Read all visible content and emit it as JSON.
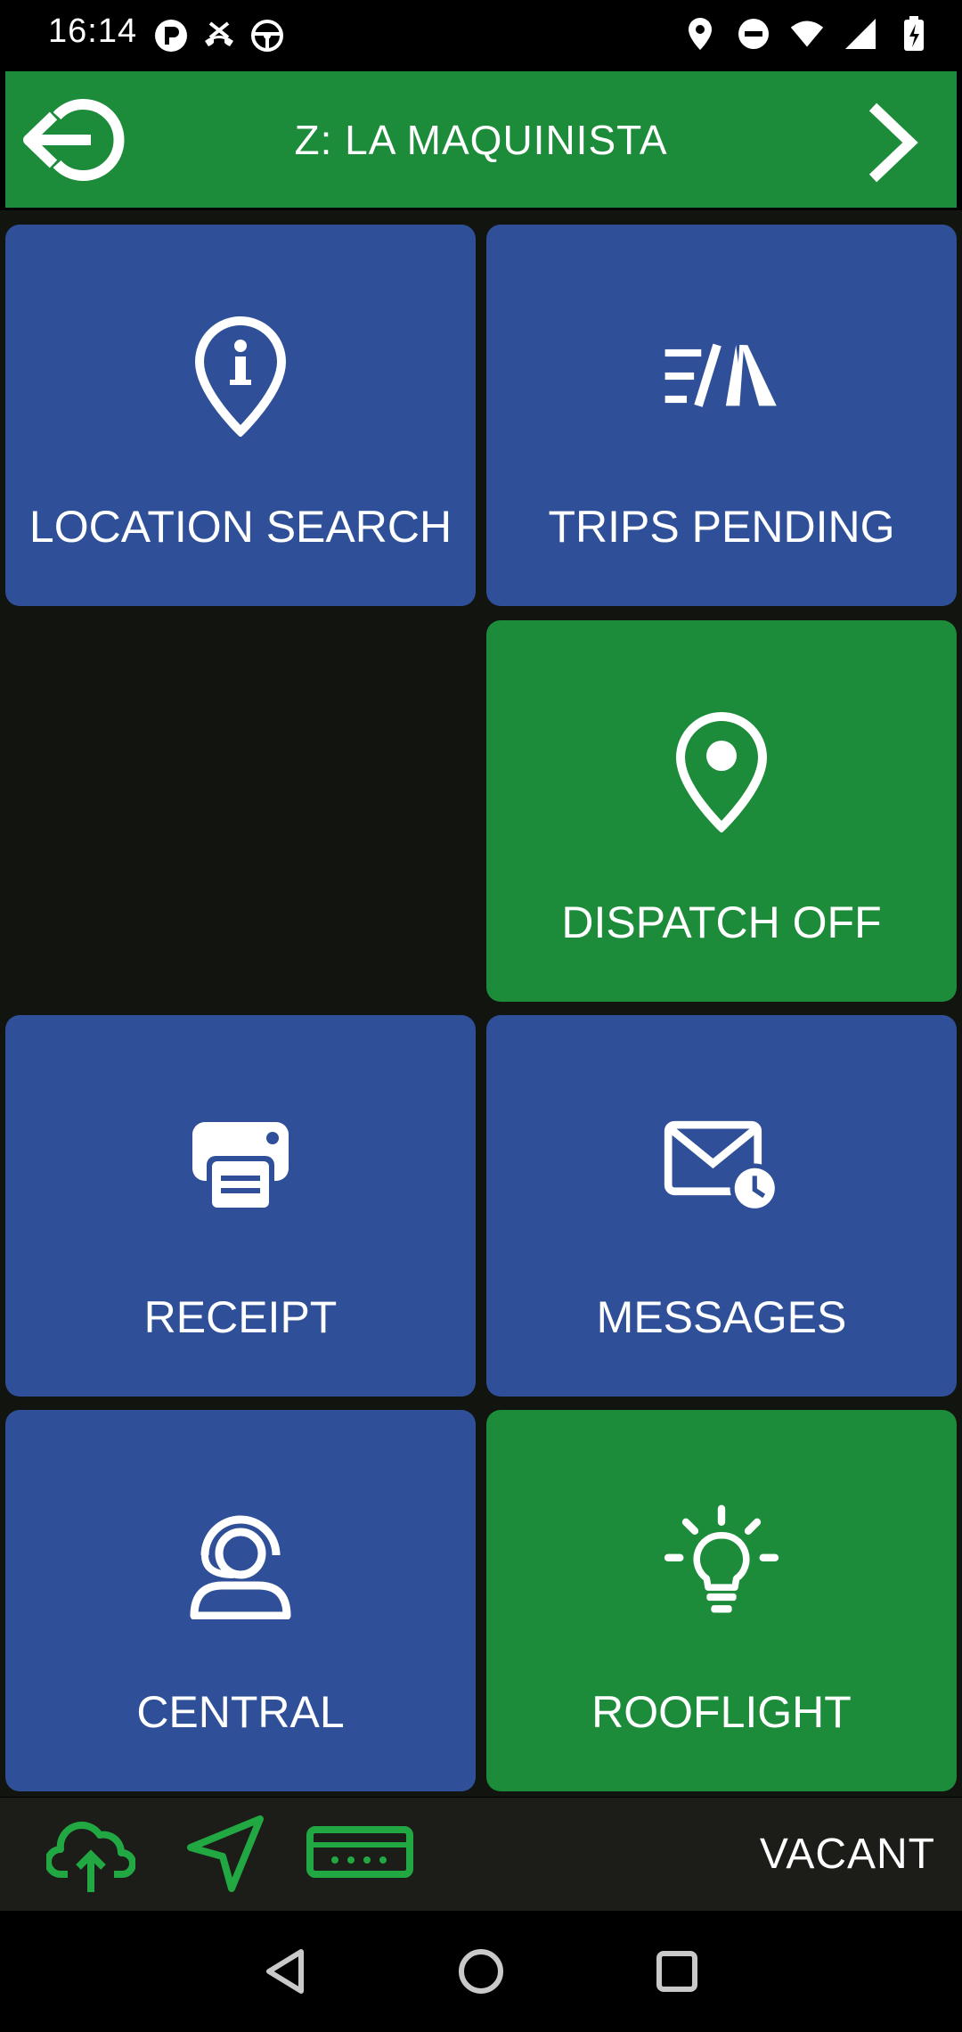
{
  "status_bar": {
    "time": "16:14",
    "left_icons": [
      "p-circle-icon",
      "call-end-icon",
      "steering-wheel-icon"
    ],
    "right_icons": [
      "location-pin-icon",
      "do-not-disturb-icon",
      "wifi-icon",
      "signal-icon",
      "battery-charging-icon"
    ]
  },
  "header": {
    "title": "Z: LA MAQUINISTA",
    "back_icon": "logout-arrow-icon",
    "next_icon": "chevron-right-icon",
    "color": "#1c8b3a"
  },
  "tiles": [
    {
      "label": "LOCATION SEARCH",
      "icon": "location-info-icon",
      "color": "#2f5098"
    },
    {
      "label": "TRIPS PENDING",
      "icon": "road-lines-icon",
      "color": "#2f5098"
    },
    {
      "label": "DISPATCH OFF",
      "icon": "map-pin-icon",
      "color": "#1c8b3a"
    },
    {
      "label": "RECEIPT",
      "icon": "printer-icon",
      "color": "#2f5098"
    },
    {
      "label": "MESSAGES",
      "icon": "mail-clock-icon",
      "color": "#2f5098"
    },
    {
      "label": "CENTRAL",
      "icon": "headset-agent-icon",
      "color": "#2f5098"
    },
    {
      "label": "ROOFLIGHT",
      "icon": "lightbulb-icon",
      "color": "#1c8b3a"
    }
  ],
  "bottom_bar": {
    "icons": [
      "cloud-upload-icon",
      "navigation-arrow-icon",
      "taximeter-icon"
    ],
    "status_label": "VACANT",
    "accent": "#22a843"
  },
  "nav_bar": {
    "buttons": [
      "back-triangle-icon",
      "home-circle-icon",
      "recents-square-icon"
    ]
  }
}
